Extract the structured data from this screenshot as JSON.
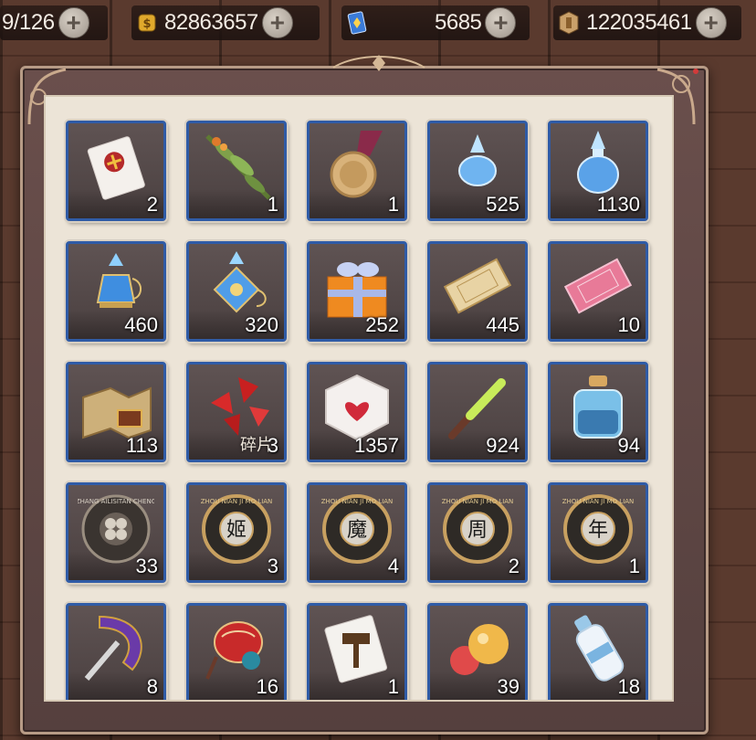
{
  "currencies": [
    {
      "name": "stamina",
      "value": "9/126",
      "icon": "stamina-icon"
    },
    {
      "name": "gold",
      "value": "82863657",
      "icon": "coin-icon"
    },
    {
      "name": "crystal",
      "value": "5685",
      "icon": "crystal-card-icon"
    },
    {
      "name": "tickets",
      "value": "122035461",
      "icon": "ticket-icon"
    }
  ],
  "items": [
    {
      "id": "gift-ticket",
      "count": "2",
      "icon": "ticket-card-icon"
    },
    {
      "id": "herb",
      "count": "1",
      "icon": "herb-bundle-icon"
    },
    {
      "id": "medal",
      "count": "1",
      "icon": "medal-icon"
    },
    {
      "id": "small-potion",
      "count": "525",
      "icon": "small-blue-potion-icon"
    },
    {
      "id": "large-potion",
      "count": "1130",
      "icon": "large-blue-potion-icon"
    },
    {
      "id": "perfume-bottle",
      "count": "460",
      "icon": "perfume-bottle-icon"
    },
    {
      "id": "ornate-perfume",
      "count": "320",
      "icon": "ornate-perfume-icon"
    },
    {
      "id": "gift-box",
      "count": "252",
      "icon": "gift-box-icon"
    },
    {
      "id": "gold-ticket",
      "count": "445",
      "icon": "gold-ticket-icon"
    },
    {
      "id": "pink-ticket",
      "count": "10",
      "icon": "pink-ticket-icon"
    },
    {
      "id": "treasure-map",
      "count": "113",
      "icon": "treasure-map-icon"
    },
    {
      "id": "red-fragments",
      "count": "3",
      "tag": "碎片",
      "icon": "red-fragment-icon"
    },
    {
      "id": "heart-dice",
      "count": "1357",
      "icon": "heart-dice-icon"
    },
    {
      "id": "glow-stick",
      "count": "924",
      "icon": "glow-stick-icon"
    },
    {
      "id": "ink-bottle",
      "count": "94",
      "icon": "ink-bottle-icon"
    },
    {
      "id": "clover-coin",
      "count": "33",
      "icon": "clover-coin-icon",
      "ring": "ZHANG AILISITAN CHENG"
    },
    {
      "id": "coin-ji",
      "count": "3",
      "icon": "coin-ji-icon",
      "glyph": "姬",
      "ring": "ZHOU NIAN JI MO LIAN"
    },
    {
      "id": "coin-mo",
      "count": "4",
      "icon": "coin-mo-icon",
      "glyph": "魔",
      "ring": "ZHOU NIAN JI MO LIAN"
    },
    {
      "id": "coin-zhou",
      "count": "2",
      "icon": "coin-zhou-icon",
      "glyph": "周",
      "ring": "ZHOU NIAN JI MO LIAN"
    },
    {
      "id": "coin-nian",
      "count": "1",
      "icon": "coin-nian-icon",
      "glyph": "年",
      "ring": "ZHOU NIAN JI MO LIAN"
    },
    {
      "id": "purple-scythe",
      "count": "8",
      "icon": "purple-scythe-icon"
    },
    {
      "id": "red-lantern",
      "count": "16",
      "icon": "red-lantern-icon"
    },
    {
      "id": "hammer-ticket",
      "count": "1",
      "icon": "hammer-ticket-icon"
    },
    {
      "id": "candy-balls",
      "count": "39",
      "icon": "candy-balls-icon"
    },
    {
      "id": "milk-bottle",
      "count": "18",
      "icon": "milk-bottle-icon"
    }
  ]
}
